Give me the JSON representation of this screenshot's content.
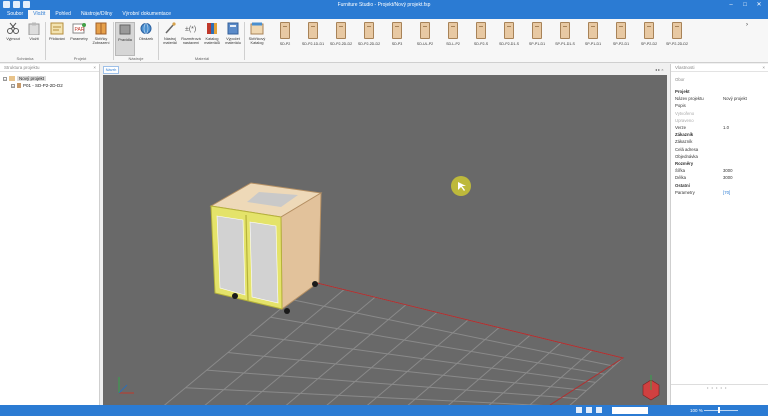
{
  "window": {
    "title": "Furniture Studio - Projekt/Nový projekt.fsp",
    "controls": [
      "–",
      "□",
      "✕"
    ]
  },
  "menu_tabs": [
    {
      "label": "Soubor",
      "active": false
    },
    {
      "label": "Vložit",
      "active": true
    },
    {
      "label": "Pohled",
      "active": false
    },
    {
      "label": "Nástroje/Dílny",
      "active": false
    },
    {
      "label": "Výrobní dokumentace",
      "active": false
    }
  ],
  "ribbon": {
    "buttons": [
      {
        "label": "Vyjmout",
        "name": "cut"
      },
      {
        "label": "Vložit",
        "name": "paste"
      },
      {
        "label": "Přidávání",
        "name": "add-note"
      },
      {
        "label": "Parametry",
        "name": "parameters"
      },
      {
        "label": "Skříňky Zobrazení",
        "name": "cabinets-view"
      },
      {
        "label": "Pravidla",
        "name": "rules"
      },
      {
        "label": "Obrázek",
        "name": "image"
      },
      {
        "label": "Nástroj materiál",
        "name": "material-tool"
      },
      {
        "label": "Rozměrová nastavení",
        "name": "dimension-settings"
      },
      {
        "label": "Katalog materiálů",
        "name": "material-catalog"
      },
      {
        "label": "Výpočet materiálu",
        "name": "material-calc"
      },
      {
        "label": "Skříňkový Katalog",
        "name": "cabinet-catalog"
      }
    ],
    "groups": [
      "Schránka",
      "Projekt",
      "Nástroje",
      "Materiál"
    ],
    "cabinets": [
      "SD-P2",
      "SD-P2-1D-D1",
      "SD-P2-2D-D2",
      "SD-P2-2D-D2",
      "SD-P3",
      "SD-UL-P2",
      "SD-L-P2",
      "SD-P2-S",
      "SD-P2-D1-S",
      "SP-P1-D1",
      "SP-P1-D1-S",
      "SP-P1-D1",
      "SP-P2-D1",
      "SP-P2-D2",
      "SP-P2-2D-D2"
    ]
  },
  "left_panel": {
    "title": "Struktura projektu",
    "tree": [
      {
        "label": "Nový projekt",
        "selected": true
      },
      {
        "label": "P01 - SD-P2-2D-D2",
        "selected": false
      }
    ]
  },
  "document_tab": {
    "label": "Návrh"
  },
  "right_panel": {
    "title": "Vlastnosti",
    "subtitle": "Obor",
    "rows": [
      {
        "label": "Projekt",
        "value": "",
        "style": "head"
      },
      {
        "label": "Název projektu",
        "value": "Nový projekt",
        "style": ""
      },
      {
        "label": "Popis",
        "value": "",
        "style": ""
      },
      {
        "label": "Vytvořeno",
        "value": "",
        "style": "dim"
      },
      {
        "label": "Upraveno",
        "value": "",
        "style": "dim"
      },
      {
        "label": "Verze",
        "value": "1.0",
        "style": ""
      },
      {
        "label": "Zákazník",
        "value": "",
        "style": "head"
      },
      {
        "label": "Zákazník",
        "value": "",
        "style": ""
      },
      {
        "label": "Celá adresa",
        "value": "",
        "style": ""
      },
      {
        "label": "Objednávka",
        "value": "",
        "style": ""
      },
      {
        "label": "Rozměry",
        "value": "",
        "style": "head"
      },
      {
        "label": "Šířka",
        "value": "3000",
        "style": ""
      },
      {
        "label": "Délka",
        "value": "3000",
        "style": ""
      },
      {
        "label": "Ostatní",
        "value": "",
        "style": "head"
      },
      {
        "label": "Parametry",
        "value": "[70]",
        "style": "link"
      }
    ],
    "footer": "• • • • •"
  },
  "status_bar": {
    "zoom": "100 %"
  },
  "colors": {
    "titlebar": "#2b7bd3",
    "viewport": "#696969",
    "cabinet_body": "#e8c9a3",
    "door_frame": "#e4e36a",
    "grid": "#8a8a8a",
    "limit_line": "#b03030"
  }
}
